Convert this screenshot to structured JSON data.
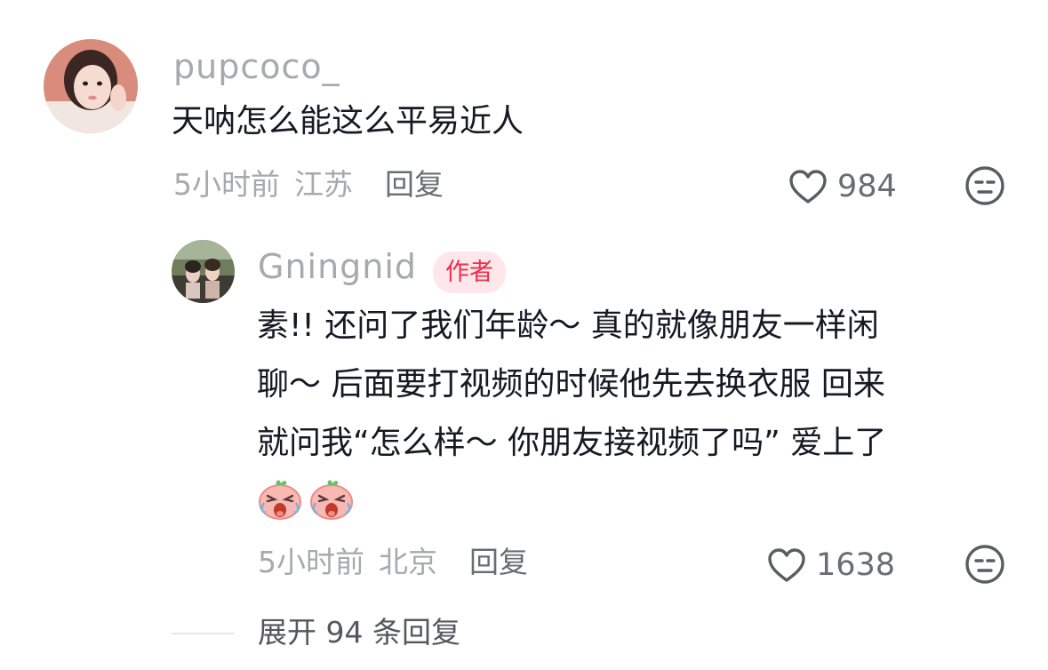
{
  "comments": [
    {
      "username": "pupcoco_",
      "text": "天呐怎么能这么平易近人",
      "time": "5小时前",
      "location": "江苏",
      "reply_label": "回复",
      "likes": "984"
    }
  ],
  "reply": {
    "username": "Gningnid",
    "badge": "作者",
    "text_lines": [
      "素!! 还问了我们年龄～ 真的就像朋友一样闲",
      "聊～ 后面要打视频的时候他先去换衣服 回来",
      "就问我“怎么样～ 你朋友接视频了吗” 爱上了"
    ],
    "emojis": [
      "crying-peach-emoji",
      "crying-peach-emoji"
    ],
    "time": "5小时前",
    "location": "北京",
    "reply_label": "回复",
    "likes": "1638"
  },
  "expand_label": "展开 94 条回复",
  "icons": {
    "like": "heart-outline-icon",
    "dislike": "unamused-face-icon"
  },
  "colors": {
    "author_badge_bg": "#fde7ea",
    "author_badge_text": "#f02c4c"
  }
}
